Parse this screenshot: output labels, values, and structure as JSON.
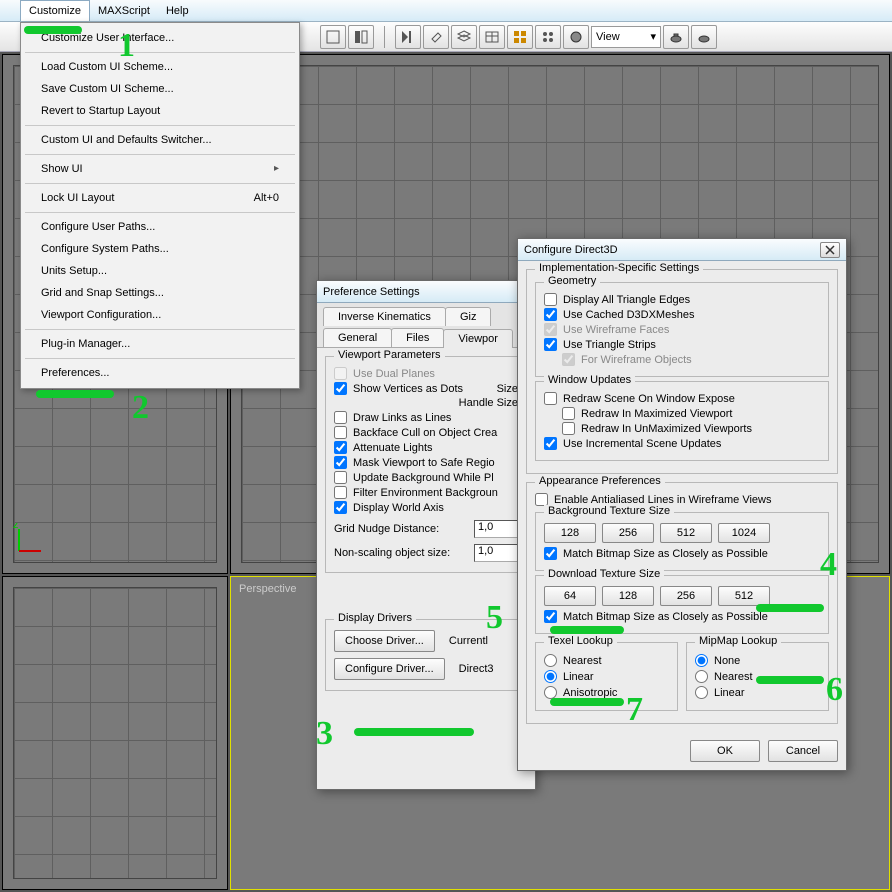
{
  "menubar": {
    "items": [
      "Customize",
      "MAXScript",
      "Help"
    ],
    "open_index": 0
  },
  "dropdown": {
    "items": [
      {
        "label": "Customize User Interface...",
        "type": "item"
      },
      {
        "type": "sep"
      },
      {
        "label": "Load Custom UI Scheme...",
        "type": "item"
      },
      {
        "label": "Save Custom UI Scheme...",
        "type": "item"
      },
      {
        "label": "Revert to Startup Layout",
        "type": "item"
      },
      {
        "type": "sep"
      },
      {
        "label": "Custom UI and Defaults Switcher...",
        "type": "item"
      },
      {
        "type": "sep"
      },
      {
        "label": "Show UI",
        "type": "item",
        "arrow": true
      },
      {
        "type": "sep"
      },
      {
        "label": "Lock UI Layout",
        "type": "item",
        "shortcut": "Alt+0"
      },
      {
        "type": "sep"
      },
      {
        "label": "Configure User Paths...",
        "type": "item"
      },
      {
        "label": "Configure System Paths...",
        "type": "item"
      },
      {
        "label": "Units Setup...",
        "type": "item"
      },
      {
        "label": "Grid and Snap Settings...",
        "type": "item"
      },
      {
        "label": "Viewport Configuration...",
        "type": "item"
      },
      {
        "type": "sep"
      },
      {
        "label": "Plug-in Manager...",
        "type": "item"
      },
      {
        "type": "sep"
      },
      {
        "label": "Preferences...",
        "type": "item"
      }
    ]
  },
  "toolbar": {
    "view_label": "View"
  },
  "viewport": {
    "bottom_left_label": "Perspective"
  },
  "pref_dialog": {
    "title": "Preference Settings",
    "tabs_row1": [
      "Inverse Kinematics",
      "Giz"
    ],
    "tabs_row2": [
      "General",
      "Files",
      "Viewpor"
    ],
    "viewport_params": {
      "legend": "Viewport Parameters",
      "items": [
        {
          "label": "Use Dual Planes",
          "checked": false,
          "disabled": true
        },
        {
          "label": "Show Vertices as Dots",
          "checked": true,
          "tail": "Size"
        },
        {
          "label_only": "Handle Size"
        },
        {
          "label": "Draw Links as Lines",
          "checked": false
        },
        {
          "label": "Backface Cull on Object Crea",
          "checked": false
        },
        {
          "label": "Attenuate Lights",
          "checked": true
        },
        {
          "label": "Mask Viewport to Safe Regio",
          "checked": true
        },
        {
          "label": "Update Background While Pl",
          "checked": false
        },
        {
          "label": "Filter Environment Backgroun",
          "checked": false
        },
        {
          "label": "Display World Axis",
          "checked": true
        }
      ],
      "grid_nudge_label": "Grid Nudge Distance:",
      "grid_nudge_value": "1,0",
      "nonscale_label": "Non-scaling object size:",
      "nonscale_value": "1,0"
    },
    "display_drivers": {
      "legend": "Display Drivers",
      "choose": "Choose Driver...",
      "currently": "Currentl",
      "configure": "Configure Driver...",
      "direct": "Direct3"
    }
  },
  "d3d_dialog": {
    "title": "Configure Direct3D",
    "impl_legend": "Implementation-Specific Settings",
    "geometry": {
      "legend": "Geometry",
      "items": [
        {
          "label": "Display All Triangle Edges",
          "checked": false
        },
        {
          "label": "Use Cached D3DXMeshes",
          "checked": true
        },
        {
          "label": "Use Wireframe Faces",
          "checked": true,
          "disabled": true
        },
        {
          "label": "Use Triangle Strips",
          "checked": true
        },
        {
          "label": "For Wireframe Objects",
          "checked": true,
          "disabled": true,
          "indent": true
        }
      ]
    },
    "window_updates": {
      "legend": "Window Updates",
      "items": [
        {
          "label": "Redraw Scene On Window Expose",
          "checked": false
        },
        {
          "label": "Redraw In Maximized Viewport",
          "checked": false,
          "indent": true
        },
        {
          "label": "Redraw In UnMaximized Viewports",
          "checked": false,
          "indent": true
        },
        {
          "label": "Use Incremental Scene Updates",
          "checked": true
        }
      ]
    },
    "appearance": {
      "legend": "Appearance Preferences",
      "enable_aa": "Enable Antialiased Lines in Wireframe Views",
      "bg_legend": "Background Texture Size",
      "bg_sizes": [
        "128",
        "256",
        "512",
        "1024"
      ],
      "bg_match": "Match Bitmap Size as Closely as Possible",
      "dl_legend": "Download Texture Size",
      "dl_sizes": [
        "64",
        "128",
        "256",
        "512"
      ],
      "dl_match": "Match Bitmap Size as Closely as Possible"
    },
    "texel": {
      "legend": "Texel Lookup",
      "options": [
        "Nearest",
        "Linear",
        "Anisotropic"
      ],
      "selected": 1
    },
    "mipmap": {
      "legend": "MipMap Lookup",
      "options": [
        "None",
        "Nearest",
        "Linear"
      ],
      "selected": 0
    },
    "ok": "OK",
    "cancel": "Cancel"
  },
  "annotations": {
    "n1": "1",
    "n2": "2",
    "n3": "3",
    "n4": "4",
    "n5": "5",
    "n6": "6",
    "n7": "7"
  }
}
